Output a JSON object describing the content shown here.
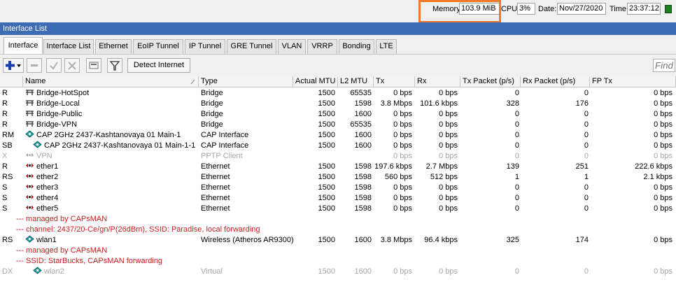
{
  "status": {
    "memory_label": "Memory:",
    "memory_value": "103.9 MiB",
    "cpu_label": "CPU:",
    "cpu_value": "3%",
    "date_label": "Date:",
    "date_value": "Nov/27/2020",
    "time_label": "Time:",
    "time_value": "23:37:12"
  },
  "window_title": "Interface List",
  "tabs": [
    "Interface",
    "Interface List",
    "Ethernet",
    "EoIP Tunnel",
    "IP Tunnel",
    "GRE Tunnel",
    "VLAN",
    "VRRP",
    "Bonding",
    "LTE"
  ],
  "toolbar": {
    "detect_label": "Detect Internet",
    "find_placeholder": "Find"
  },
  "columns": [
    "",
    "Name",
    "Type",
    "Actual MTU",
    "L2 MTU",
    "Tx",
    "Rx",
    "Tx Packet (p/s)",
    "Rx Packet (p/s)",
    "FP Tx"
  ],
  "rows": [
    {
      "kind": "data",
      "flags": "R",
      "icon": "bridge-icon",
      "indent": 0,
      "name": "Bridge-HotSpot",
      "type": "Bridge",
      "mtu": "1500",
      "l2mtu": "65535",
      "tx": "0 bps",
      "rx": "0 bps",
      "txp": "0",
      "rxp": "0",
      "fptx": "0 bps",
      "disabled": false
    },
    {
      "kind": "data",
      "flags": "R",
      "icon": "bridge-icon",
      "indent": 0,
      "name": "Bridge-Local",
      "type": "Bridge",
      "mtu": "1500",
      "l2mtu": "1598",
      "tx": "3.8 Mbps",
      "rx": "101.6 kbps",
      "txp": "328",
      "rxp": "176",
      "fptx": "0 bps",
      "disabled": false
    },
    {
      "kind": "data",
      "flags": "R",
      "icon": "bridge-icon",
      "indent": 0,
      "name": "Bridge-Public",
      "type": "Bridge",
      "mtu": "1500",
      "l2mtu": "1600",
      "tx": "0 bps",
      "rx": "0 bps",
      "txp": "0",
      "rxp": "0",
      "fptx": "0 bps",
      "disabled": false
    },
    {
      "kind": "data",
      "flags": "R",
      "icon": "bridge-icon",
      "indent": 0,
      "name": "Bridge-VPN",
      "type": "Bridge",
      "mtu": "1500",
      "l2mtu": "65535",
      "tx": "0 bps",
      "rx": "0 bps",
      "txp": "0",
      "rxp": "0",
      "fptx": "0 bps",
      "disabled": false
    },
    {
      "kind": "data",
      "flags": "RM",
      "icon": "wireless-icon",
      "indent": 0,
      "name": "CAP 2GHz 2437-Kashtanovaya 01 Main-1",
      "type": "CAP Interface",
      "mtu": "1500",
      "l2mtu": "1600",
      "tx": "0 bps",
      "rx": "0 bps",
      "txp": "0",
      "rxp": "0",
      "fptx": "0 bps",
      "disabled": false
    },
    {
      "kind": "data",
      "flags": "SB",
      "icon": "wireless-icon",
      "indent": 1,
      "name": "CAP 2GHz 2437-Kashtanovaya 01 Main-1-1",
      "type": "CAP Interface",
      "mtu": "1500",
      "l2mtu": "1600",
      "tx": "0 bps",
      "rx": "0 bps",
      "txp": "0",
      "rxp": "0",
      "fptx": "0 bps",
      "disabled": false
    },
    {
      "kind": "data",
      "flags": "X",
      "icon": "tunnel-icon",
      "indent": 0,
      "name": "VPN",
      "type": "PPTP Client",
      "mtu": "",
      "l2mtu": "",
      "tx": "0 bps",
      "rx": "0 bps",
      "txp": "0",
      "rxp": "0",
      "fptx": "0 bps",
      "disabled": true
    },
    {
      "kind": "data",
      "flags": "R",
      "icon": "ethernet-icon",
      "indent": 0,
      "name": "ether1",
      "type": "Ethernet",
      "mtu": "1500",
      "l2mtu": "1598",
      "tx": "197.6 kbps",
      "rx": "2.7 Mbps",
      "txp": "139",
      "rxp": "251",
      "fptx": "222.6 kbps",
      "disabled": false
    },
    {
      "kind": "data",
      "flags": "RS",
      "icon": "ethernet-icon",
      "indent": 0,
      "name": "ether2",
      "type": "Ethernet",
      "mtu": "1500",
      "l2mtu": "1598",
      "tx": "560 bps",
      "rx": "512 bps",
      "txp": "1",
      "rxp": "1",
      "fptx": "2.1 kbps",
      "disabled": false
    },
    {
      "kind": "data",
      "flags": "S",
      "icon": "ethernet-icon",
      "indent": 0,
      "name": "ether3",
      "type": "Ethernet",
      "mtu": "1500",
      "l2mtu": "1598",
      "tx": "0 bps",
      "rx": "0 bps",
      "txp": "0",
      "rxp": "0",
      "fptx": "0 bps",
      "disabled": false
    },
    {
      "kind": "data",
      "flags": "S",
      "icon": "ethernet-icon",
      "indent": 0,
      "name": "ether4",
      "type": "Ethernet",
      "mtu": "1500",
      "l2mtu": "1598",
      "tx": "0 bps",
      "rx": "0 bps",
      "txp": "0",
      "rxp": "0",
      "fptx": "0 bps",
      "disabled": false
    },
    {
      "kind": "data",
      "flags": "S",
      "icon": "ethernet-icon",
      "indent": 0,
      "name": "ether5",
      "type": "Ethernet",
      "mtu": "1500",
      "l2mtu": "1598",
      "tx": "0 bps",
      "rx": "0 bps",
      "txp": "0",
      "rxp": "0",
      "fptx": "0 bps",
      "disabled": false
    },
    {
      "kind": "comment",
      "text": "--- managed by CAPsMAN"
    },
    {
      "kind": "comment",
      "text": "--- channel: 2437/20-Ce/gn/P(26dBm), SSID: Paradise, local forwarding"
    },
    {
      "kind": "data",
      "flags": "RS",
      "icon": "wireless-icon",
      "indent": 0,
      "name": "wlan1",
      "type": "Wireless (Atheros AR9300)",
      "mtu": "1500",
      "l2mtu": "1600",
      "tx": "3.8 Mbps",
      "rx": "96.4 kbps",
      "txp": "325",
      "rxp": "174",
      "fptx": "0 bps",
      "disabled": false
    },
    {
      "kind": "comment",
      "text": "--- managed by CAPsMAN"
    },
    {
      "kind": "comment",
      "text": "--- SSID: StarBucks, CAPsMAN forwarding"
    },
    {
      "kind": "data",
      "flags": "DX",
      "icon": "wireless-icon",
      "indent": 1,
      "name": "wlan2",
      "type": "Virtual",
      "mtu": "1500",
      "l2mtu": "1600",
      "tx": "0 bps",
      "rx": "0 bps",
      "txp": "0",
      "rxp": "0",
      "fptx": "0 bps",
      "disabled": true
    }
  ]
}
